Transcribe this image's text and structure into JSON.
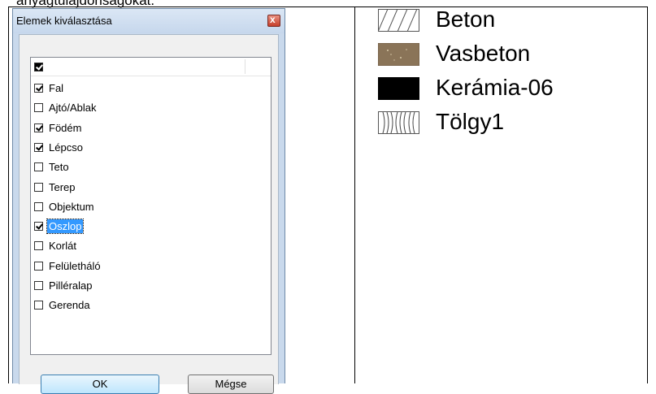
{
  "page_caption": "anyagtulajdonságokat.",
  "dialog": {
    "title": "Elemek kiválasztása",
    "close_label": "x",
    "header_checked": true,
    "items": [
      {
        "label": "Fal",
        "checked": true,
        "selected": false
      },
      {
        "label": "Ajtó/Ablak",
        "checked": false,
        "selected": false
      },
      {
        "label": "Födém",
        "checked": true,
        "selected": false
      },
      {
        "label": "Lépcso",
        "checked": true,
        "selected": false
      },
      {
        "label": "Teto",
        "checked": false,
        "selected": false
      },
      {
        "label": "Terep",
        "checked": false,
        "selected": false
      },
      {
        "label": "Objektum",
        "checked": false,
        "selected": false
      },
      {
        "label": "Oszlop",
        "checked": true,
        "selected": true
      },
      {
        "label": "Korlát",
        "checked": false,
        "selected": false
      },
      {
        "label": "Felületháló",
        "checked": false,
        "selected": false
      },
      {
        "label": "Pilléralap",
        "checked": false,
        "selected": false
      },
      {
        "label": "Gerenda",
        "checked": false,
        "selected": false
      }
    ],
    "ok_label": "OK",
    "cancel_label": "Mégse"
  },
  "legend": [
    {
      "label": "Beton",
      "swatch": "hatch-diagonal",
      "color": "#ffffff"
    },
    {
      "label": "Vasbeton",
      "swatch": "brown-texture",
      "color": "#8a7458"
    },
    {
      "label": "Kerámia-06",
      "swatch": "solid-black",
      "color": "#000000"
    },
    {
      "label": "Tölgy1",
      "swatch": "wood-grain",
      "color": "#ffffff"
    }
  ]
}
